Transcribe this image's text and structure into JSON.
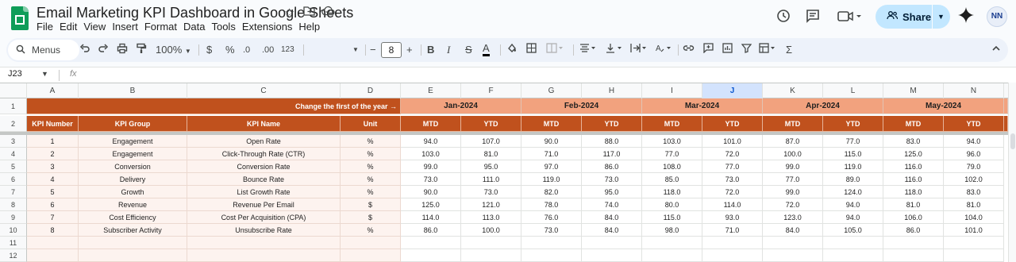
{
  "app": {
    "title": "Email Marketing KPI Dashboard in Google Sheets",
    "menus": [
      "File",
      "Edit",
      "View",
      "Insert",
      "Format",
      "Data",
      "Tools",
      "Extensions",
      "Help"
    ],
    "share_label": "Share",
    "avatar_text": "NN"
  },
  "toolbar": {
    "menus_search": "Menus",
    "zoom": "100%",
    "currency": "$",
    "percent": "%",
    "dec_decrease": ".0",
    "dec_increase": ".00",
    "more_formats": "123",
    "font_size": "8",
    "minus": "−",
    "plus": "+",
    "bold": "B",
    "strike": "S",
    "text_color": "A"
  },
  "formula_bar": {
    "name_box": "J23",
    "fx": "fx"
  },
  "grid": {
    "columns": [
      "A",
      "B",
      "C",
      "D",
      "E",
      "F",
      "G",
      "H",
      "I",
      "J",
      "K",
      "L",
      "M",
      "N"
    ],
    "selected_column": "J",
    "row_numbers": [
      "1",
      "2",
      "3",
      "4",
      "5",
      "6",
      "7",
      "8",
      "9",
      "10",
      "11",
      "12"
    ],
    "row1_note": "Change the first of the year →",
    "months": [
      "Jan-2024",
      "Feb-2024",
      "Mar-2024",
      "Apr-2024",
      "May-2024"
    ],
    "headers": [
      "KPI Number",
      "KPI Group",
      "KPI Name",
      "Unit"
    ],
    "sub_headers": [
      "MTD",
      "YTD"
    ],
    "rows": [
      {
        "num": "1",
        "group": "Engagement",
        "name": "Open Rate",
        "unit": "%",
        "values": [
          "94.0",
          "107.0",
          "90.0",
          "88.0",
          "103.0",
          "101.0",
          "87.0",
          "77.0",
          "83.0",
          "94.0"
        ]
      },
      {
        "num": "2",
        "group": "Engagement",
        "name": "Click-Through Rate (CTR)",
        "unit": "%",
        "values": [
          "103.0",
          "81.0",
          "71.0",
          "117.0",
          "77.0",
          "72.0",
          "100.0",
          "115.0",
          "125.0",
          "96.0"
        ]
      },
      {
        "num": "3",
        "group": "Conversion",
        "name": "Conversion Rate",
        "unit": "%",
        "values": [
          "99.0",
          "95.0",
          "97.0",
          "86.0",
          "108.0",
          "77.0",
          "99.0",
          "119.0",
          "116.0",
          "79.0"
        ]
      },
      {
        "num": "4",
        "group": "Delivery",
        "name": "Bounce Rate",
        "unit": "%",
        "values": [
          "73.0",
          "111.0",
          "119.0",
          "73.0",
          "85.0",
          "73.0",
          "77.0",
          "89.0",
          "116.0",
          "102.0"
        ]
      },
      {
        "num": "5",
        "group": "Growth",
        "name": "List Growth Rate",
        "unit": "%",
        "values": [
          "90.0",
          "73.0",
          "82.0",
          "95.0",
          "118.0",
          "72.0",
          "99.0",
          "124.0",
          "118.0",
          "83.0"
        ]
      },
      {
        "num": "6",
        "group": "Revenue",
        "name": "Revenue Per Email",
        "unit": "$",
        "values": [
          "125.0",
          "121.0",
          "78.0",
          "74.0",
          "80.0",
          "114.0",
          "72.0",
          "94.0",
          "81.0",
          "81.0"
        ]
      },
      {
        "num": "7",
        "group": "Cost Efficiency",
        "name": "Cost Per Acquisition (CPA)",
        "unit": "$",
        "values": [
          "114.0",
          "113.0",
          "76.0",
          "84.0",
          "115.0",
          "93.0",
          "123.0",
          "94.0",
          "106.0",
          "104.0"
        ]
      },
      {
        "num": "8",
        "group": "Subscriber Activity",
        "name": "Unsubscribe Rate",
        "unit": "%",
        "values": [
          "86.0",
          "100.0",
          "73.0",
          "84.0",
          "98.0",
          "71.0",
          "84.0",
          "105.0",
          "86.0",
          "101.0"
        ]
      }
    ]
  }
}
